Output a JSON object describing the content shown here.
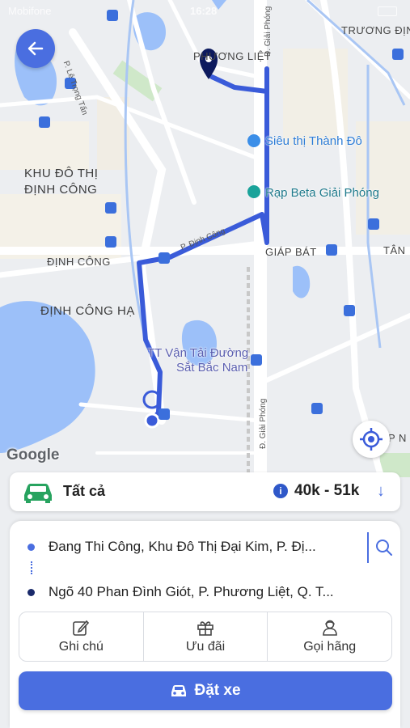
{
  "status_bar": {
    "carrier": "Mobifone",
    "time": "16:28"
  },
  "map": {
    "attribution": "Google",
    "area_labels": [
      {
        "id": "phuong-liet",
        "text": "PHƯƠNG LIỆT"
      },
      {
        "id": "truong-dinh",
        "text": "TRƯƠNG ĐỊNH"
      },
      {
        "id": "khu-do-thi-1",
        "text": "KHU ĐÔ THỊ"
      },
      {
        "id": "khu-do-thi-2",
        "text": "ĐỊNH CÔNG"
      },
      {
        "id": "dinh-cong",
        "text": "ĐỊNH CÔNG"
      },
      {
        "id": "dinh-cong-ha",
        "text": "ĐỊNH CÔNG HẠ"
      },
      {
        "id": "giap-bat",
        "text": "GIÁP BÁT"
      },
      {
        "id": "tan",
        "text": "TÂN"
      },
      {
        "id": "p-n",
        "text": "P N"
      }
    ],
    "poi_labels": [
      {
        "id": "sieu-thi",
        "text": "Siêu thị Thành Đô"
      },
      {
        "id": "rap-beta",
        "text": "Rạp Beta Giải Phóng"
      },
      {
        "id": "ga-1",
        "text": "TT Vận Tải Đường"
      },
      {
        "id": "ga-2",
        "text": "Sắt Bắc Nam"
      }
    ],
    "street_labels": [
      {
        "id": "le-trong-tan",
        "text": "P. Lê Trọng Tấn"
      },
      {
        "id": "dinh-cong-st",
        "text": "P. Định Công"
      },
      {
        "id": "giai-phong-top",
        "text": "Đ. Giải Phóng"
      },
      {
        "id": "giai-phong-bottom",
        "text": "Đ. Giải Phóng"
      }
    ]
  },
  "fare_bar": {
    "vehicle_label": "Tất cả",
    "price": "40k - 51k",
    "info_glyph": "i",
    "sort_glyph": "↓",
    "icons": [
      "car-icon",
      "info-icon",
      "arrow-down-icon"
    ]
  },
  "route": {
    "origin": "Đang Thi Công, Khu Đô Thị Đại Kim, P. Đị...",
    "destination": "Ngõ 40 Phan Đình Giót, P. Phương Liệt, Q. T..."
  },
  "actions": [
    {
      "id": "note",
      "label": "Ghi chú",
      "icon": "pencil-icon"
    },
    {
      "id": "promo",
      "label": "Ưu đãi",
      "icon": "gift-icon"
    },
    {
      "id": "call",
      "label": "Gọi hãng",
      "icon": "operator-icon"
    }
  ],
  "book_button": {
    "label": "Đặt xe",
    "icon": "car-icon"
  },
  "colors": {
    "primary": "#4a6ee0",
    "route": "#3a5bd9",
    "origin_dot": "#4a6ee0",
    "dest_dot": "#1a2a6b",
    "car": "#27a35f"
  }
}
